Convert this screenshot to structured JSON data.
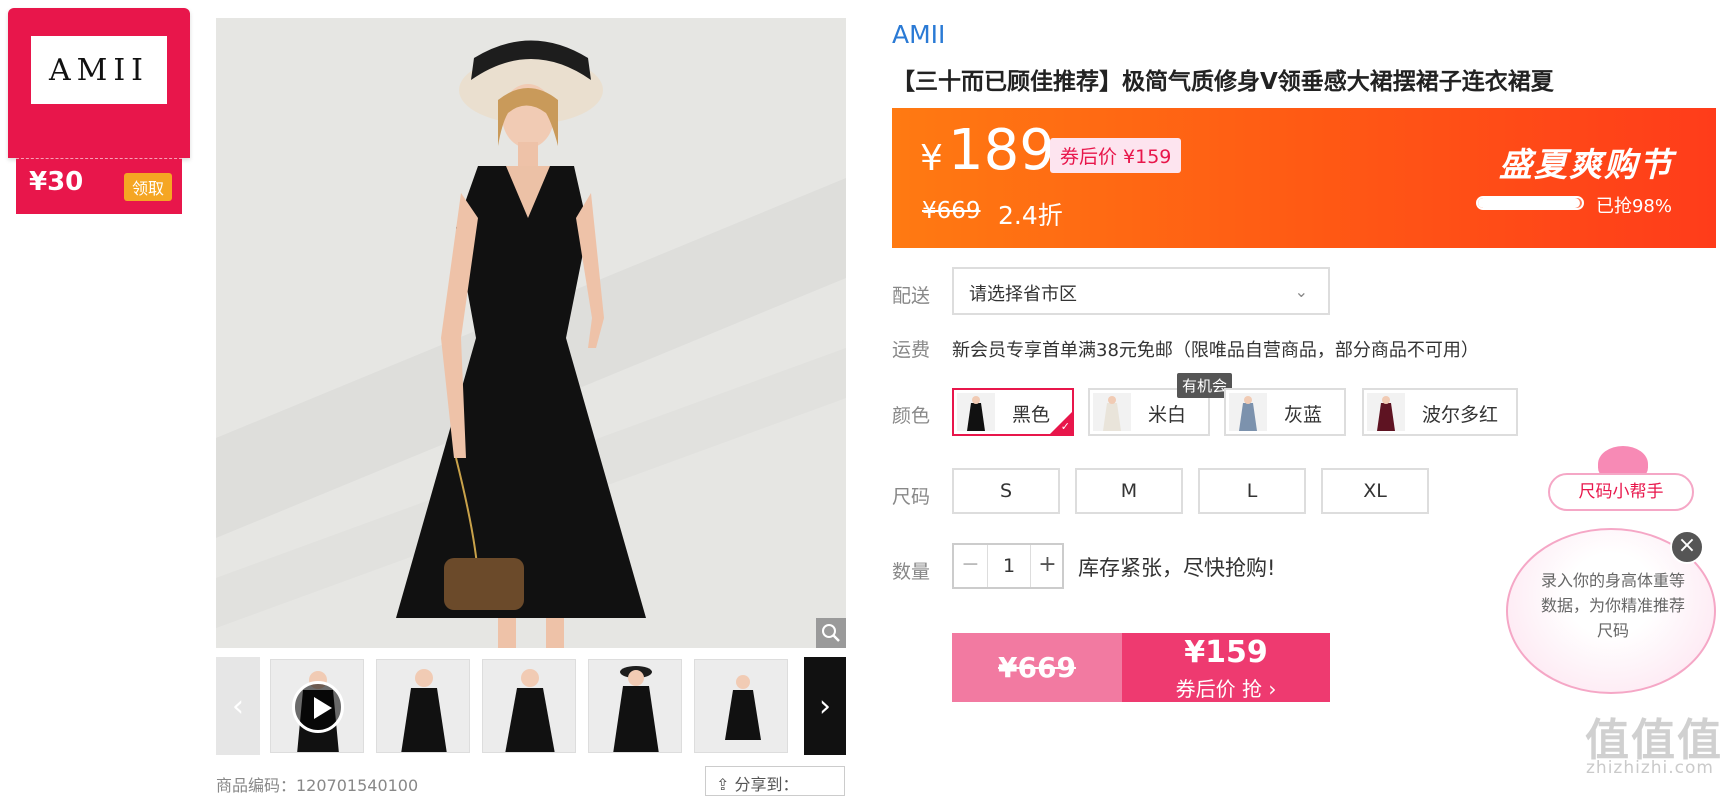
{
  "coupon": {
    "logo_text": "AMII",
    "amount": "¥30",
    "claim_label": "领取"
  },
  "gallery": {
    "zoom_icon": "magnifier-icon",
    "prev_icon": "chevron-left-icon",
    "next_icon": "chevron-right-icon",
    "play_icon": "play-icon",
    "thumbnail_count": 6
  },
  "footer": {
    "product_code": "商品编码：120701540100",
    "share_label": "分享到："
  },
  "product": {
    "brand": "AMII",
    "title": "【三十而已顾佳推荐】极简气质修身V领垂感大裙摆裙子连衣裙夏"
  },
  "price": {
    "currency": "¥",
    "current": "189",
    "after_coupon": "券后价 ¥159",
    "original": "¥669",
    "discount": "2.4折",
    "festival": "盛夏爽购节",
    "sold_percent": 98,
    "sold_label": "已抢98%"
  },
  "delivery": {
    "label": "配送",
    "placeholder": "请选择省市区"
  },
  "shipping": {
    "label": "运费",
    "text": "新会员专享首单满38元免邮（限唯品自营商品，部分商品不可用）"
  },
  "colors": {
    "label": "颜色",
    "tip": "有机会",
    "options": [
      {
        "name": "黑色",
        "selected": true
      },
      {
        "name": "米白",
        "selected": false
      },
      {
        "name": "灰蓝",
        "selected": false
      },
      {
        "name": "波尔多红",
        "selected": false
      }
    ]
  },
  "sizes": {
    "label": "尺码",
    "options": [
      "S",
      "M",
      "L",
      "XL"
    ]
  },
  "quantity": {
    "label": "数量",
    "minus": "−",
    "value": "1",
    "plus": "+",
    "stock_note": "库存紧张，尽快抢购!"
  },
  "buy": {
    "original": "¥669",
    "price": "¥159",
    "label": "券后价 抢 ›"
  },
  "size_helper": {
    "title": "尺码小帮手",
    "text": "录入你的身高体重等数据，为你精准推荐尺码",
    "close": "×"
  },
  "watermark": {
    "text": "值值值",
    "url": "zhizhizhi.com"
  },
  "colors_theme": {
    "accent_pink": "#e8164b",
    "brand_blue": "#2a7ad5",
    "banner_orange": "#ff5a14"
  }
}
